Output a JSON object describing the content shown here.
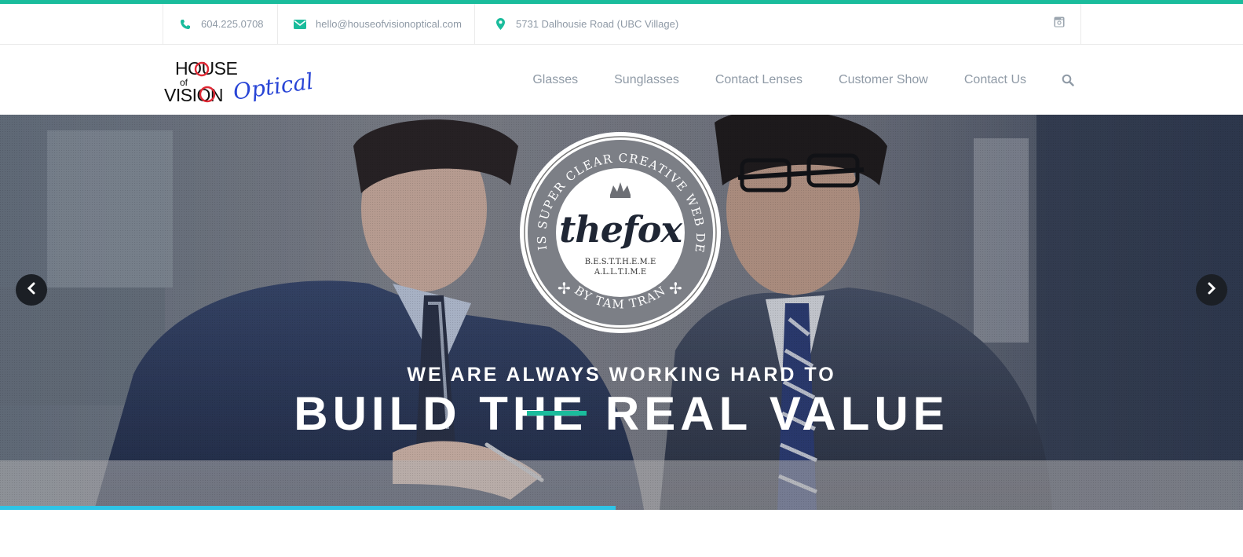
{
  "colors": {
    "accent": "#1abc9c",
    "progress": "#2ec4e6",
    "text_muted": "#8f9aa6",
    "badge_dark": "#1f2634"
  },
  "topbar": {
    "phone": "604.225.0708",
    "phone_icon": "phone-icon",
    "email": "hello@houseofvisionoptical.com",
    "email_icon": "envelope-icon",
    "address": "5731 Dalhousie Road (UBC Village)",
    "address_icon": "map-marker-icon",
    "social_icon": "instagram-icon"
  },
  "logo": {
    "line1": "HOUSE",
    "of": "of",
    "line2": "VISION",
    "script": "Optical"
  },
  "nav": {
    "items": [
      "Glasses",
      "Sunglasses",
      "Contact Lenses",
      "Customer Show",
      "Contact Us"
    ],
    "search_icon": "search-icon"
  },
  "hero": {
    "badge": {
      "ring_top": "THIS IS SUPER CLEAR CREATIVE WEB DESIGN",
      "ring_bottom": "BY TAM TRAN",
      "brand": "thefox",
      "line1": "B.E.S.T.T.H.E.M.E",
      "line2": "A.L.L.T.I.M.E"
    },
    "subtitle": "WE ARE ALWAYS WORKING HARD TO",
    "title": "BUILD THE REAL VALUE",
    "progress": 0.495
  }
}
